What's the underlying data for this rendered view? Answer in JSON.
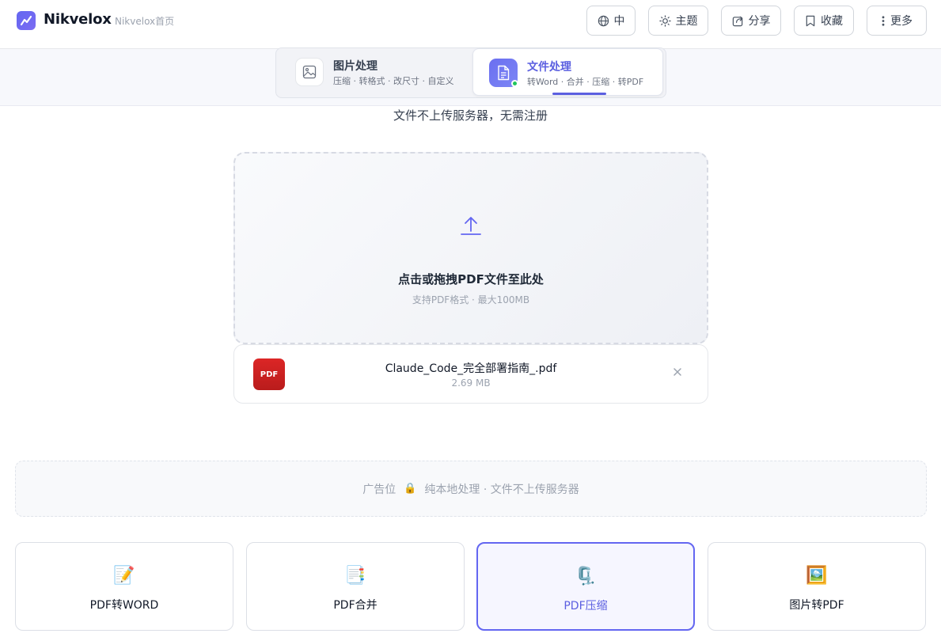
{
  "header": {
    "brand": "Nikvelox",
    "home_link": "Nikvelox首页",
    "buttons": [
      {
        "id": "language",
        "label": "中",
        "icon": "globe-icon"
      },
      {
        "id": "theme",
        "label": "主题",
        "icon": "sun-icon"
      },
      {
        "id": "share",
        "label": "分享",
        "icon": "share-icon"
      },
      {
        "id": "bookmark",
        "label": "收藏",
        "icon": "bookmark-icon"
      },
      {
        "id": "more",
        "label": "更多",
        "icon": "more-vertical-icon"
      }
    ]
  },
  "tabs": [
    {
      "title": "图片处理",
      "subtitle": "压缩 · 转格式 · 改尺寸 · 自定义",
      "icon": "image-icon",
      "active": false
    },
    {
      "title": "文件处理",
      "subtitle": "转Word · 合并 · 压缩 · 转PDF",
      "icon": "document-icon",
      "active": true
    }
  ],
  "note": "文件不上传服务器，无需注册",
  "dropzone": {
    "title": "点击或拖拽PDF文件至此处",
    "hint": "支持PDF格式 · 最大100MB"
  },
  "file": {
    "badge": "PDF",
    "name": "Claude_Code_完全部署指南_.pdf",
    "size": "2.69 MB",
    "remove": "×"
  },
  "ad": {
    "label": "广告位",
    "lock": "🔒",
    "text": "纯本地处理 · 文件不上传服务器"
  },
  "tools": [
    {
      "label": "PDF转WORD",
      "icon": "📝",
      "active": false
    },
    {
      "label": "PDF合并",
      "icon": "📑",
      "active": false
    },
    {
      "label": "PDF压缩",
      "icon": "🗜️",
      "active": true
    },
    {
      "label": "图片转PDF",
      "icon": "🖼️",
      "active": false
    }
  ],
  "colors": {
    "accent": "#6366f1",
    "pdf_red": "#dc2626",
    "status_green": "#22c55e"
  }
}
